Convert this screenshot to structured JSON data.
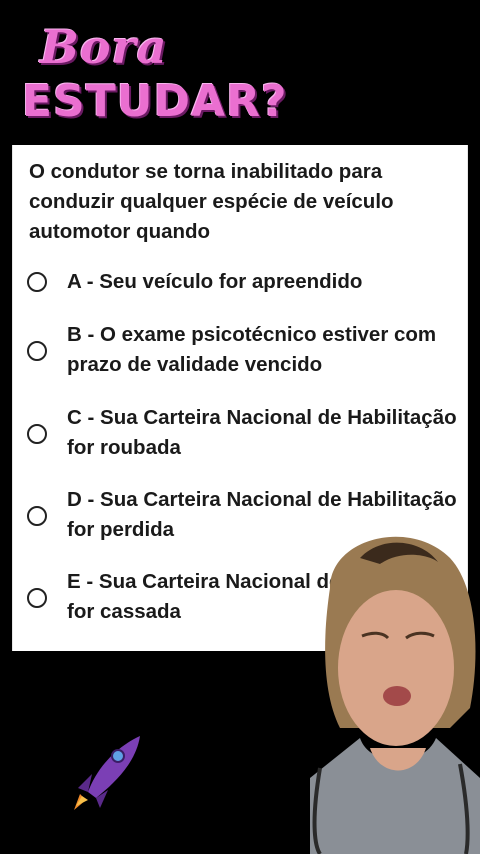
{
  "banner": {
    "line1": "Bora",
    "line2": "ESTUDAR?"
  },
  "quiz": {
    "question": "O condutor se torna inabilitado para conduzir qualquer espécie de veículo automotor quando",
    "options": [
      {
        "label": "A - Seu veículo for apreendido",
        "selected": false
      },
      {
        "label": "B - O exame psicotécnico estiver com prazo de validade vencido",
        "selected": false
      },
      {
        "label": "C - Sua Carteira Nacional de Habilitação for roubada",
        "selected": false
      },
      {
        "label": "D - Sua Carteira Nacional de Habilitação for perdida",
        "selected": false
      },
      {
        "label": "E - Sua Carteira Nacional de Habilitação for cassada",
        "selected": false
      }
    ]
  },
  "colors": {
    "logo_pink": "#ea6fd0",
    "rocket_purple": "#7b3fb5",
    "card_bg": "#ffffff"
  },
  "icons": {
    "rocket": "rocket-icon",
    "radio": "radio-icon"
  }
}
